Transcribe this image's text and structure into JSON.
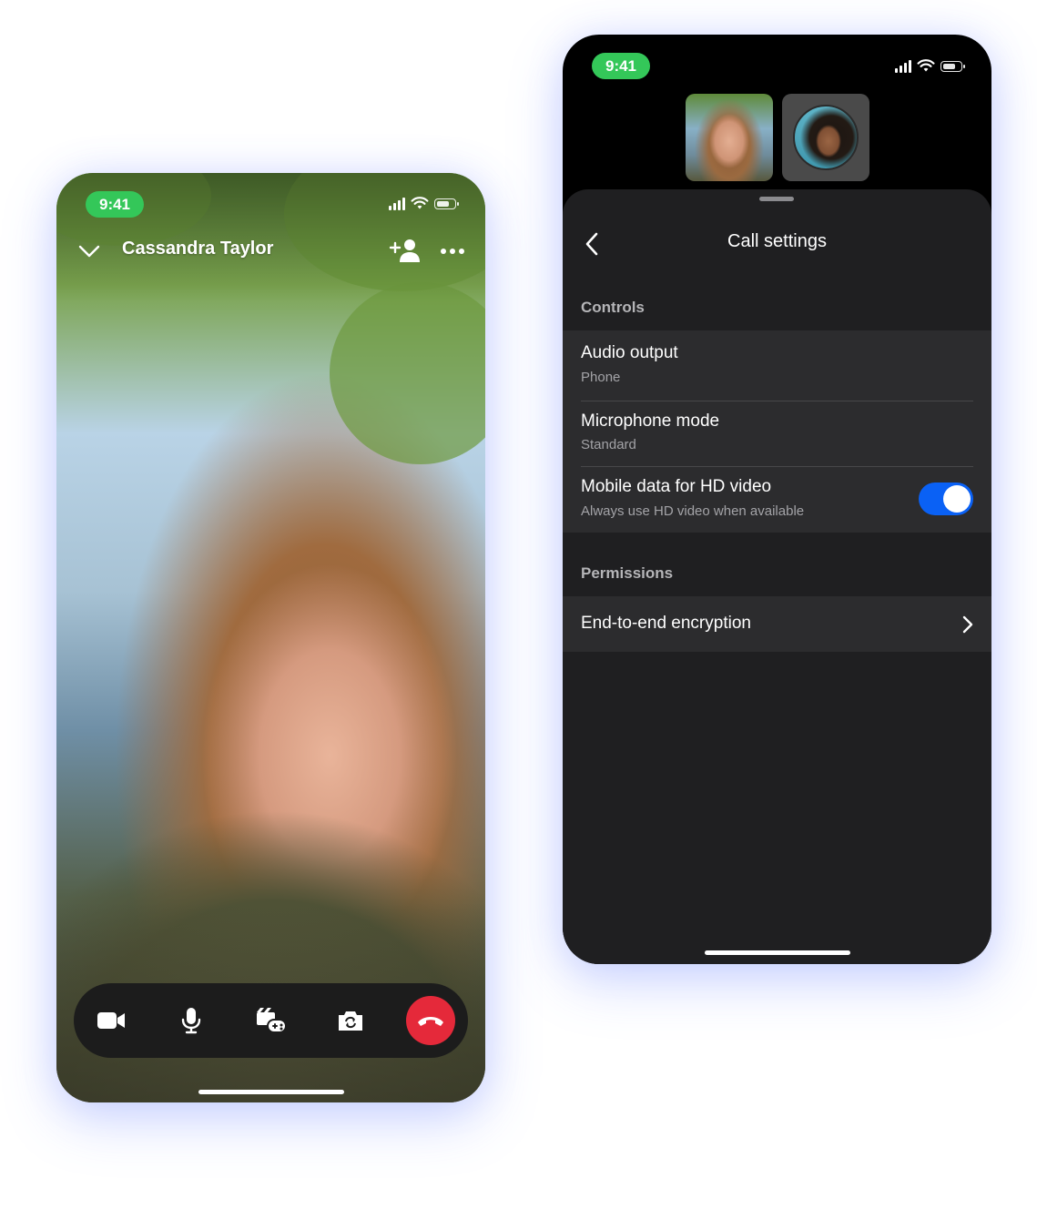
{
  "left_phone": {
    "status_time": "9:41",
    "contact_name": "Cassandra Taylor",
    "icons": {
      "collapse": "chevron-down-icon",
      "add_person": "add-person-icon",
      "more": "more-dots-icon",
      "video": "video-camera-icon",
      "mic": "microphone-icon",
      "effects": "effects-icon",
      "flip_camera": "flip-camera-icon",
      "end_call": "end-call-icon"
    },
    "colors": {
      "status_pill": "#34c759",
      "end_call": "#e5293a",
      "control_bar": "#1c1c1c"
    }
  },
  "right_phone": {
    "status_time": "9:41",
    "sheet": {
      "title": "Call settings",
      "controls_label": "Controls",
      "audio_output": {
        "title": "Audio output",
        "value": "Phone"
      },
      "microphone_mode": {
        "title": "Microphone mode",
        "value": "Standard"
      },
      "hd_video": {
        "title": "Mobile data for HD video",
        "subtitle": "Always use HD video when available",
        "enabled": true
      },
      "permissions_label": "Permissions",
      "encryption": {
        "title": "End-to-end encryption"
      }
    },
    "colors": {
      "toggle_on": "#0a61f5",
      "sheet_bg": "#1f1f21",
      "row_bg": "#2c2c2e"
    }
  }
}
